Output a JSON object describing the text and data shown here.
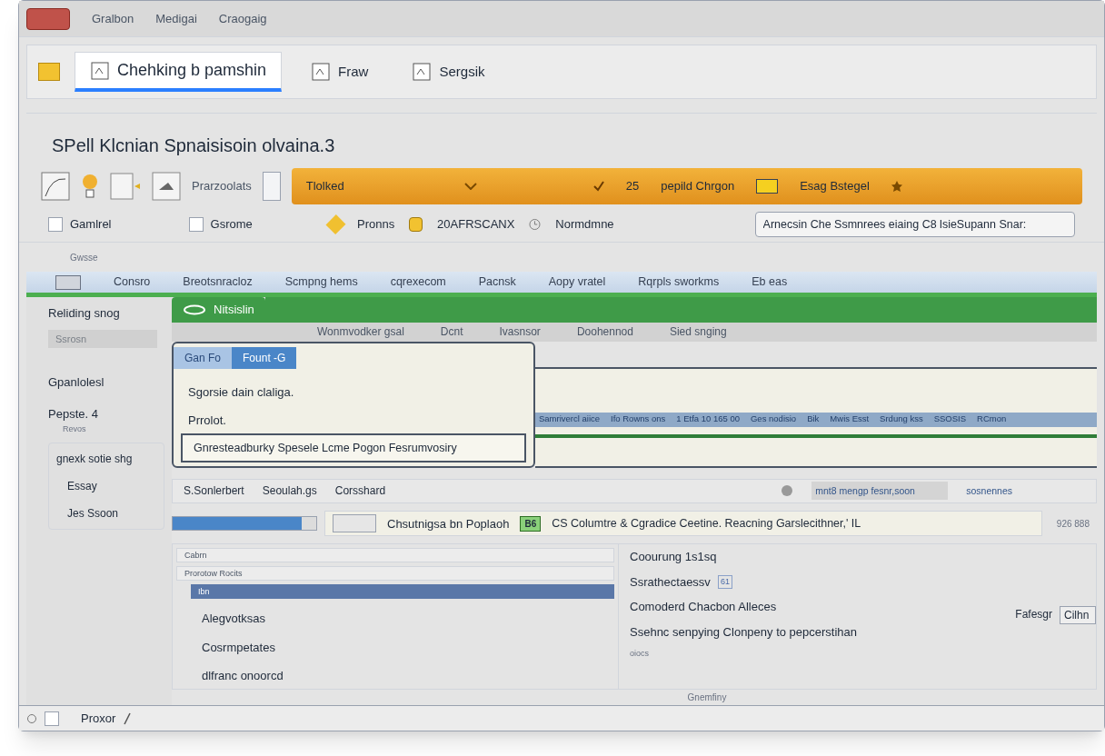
{
  "window": {
    "title_items": [
      "Gralbon",
      "Medigai",
      "Craogaig"
    ]
  },
  "toolbar": {
    "tabs": [
      {
        "label": "Chehking b pamshin",
        "selected": true
      },
      {
        "label": "Fraw",
        "selected": false
      },
      {
        "label": "Sergsik",
        "selected": false
      }
    ]
  },
  "heading": "SPell Klcnian Spnaisisoin olvaina.3",
  "ribbon": {
    "label": "Prarzoolats",
    "banner": {
      "dropdown": "Tlolked",
      "count": "25",
      "text": "pepild Chrgon",
      "tag": "Esag Bstegel"
    }
  },
  "options": {
    "checks": [
      {
        "label": "Gamlrel",
        "checked": false
      },
      {
        "label": "Gsrome",
        "checked": false
      }
    ],
    "tags": [
      "Pronns",
      "20AFRSCANX"
    ],
    "mode": "Normdmne",
    "field": {
      "value": "Arnecsin Che Ssmnrees eiaing C8 lsieSupann Snar:"
    }
  },
  "section_label": "Gwsse",
  "nav_bar": {
    "items": [
      "Consro",
      "Breotsnracloz",
      "Scmpng hems",
      "cqrexecom",
      "Pacnsk",
      "Aopy vratel",
      "Rqrpls sworkms",
      "Eb eas"
    ]
  },
  "sidebar": {
    "title": "Reliding snog",
    "search": {
      "placeholder": "Ssrosn"
    },
    "heading": "Gpanlolesl",
    "page": "Pepste. 4",
    "sub": "Revos",
    "group": {
      "title": "gnexk sotie shg",
      "items": [
        "Essay",
        "Jes Ssoon"
      ]
    }
  },
  "doc_tab": {
    "label": "Nitsislin"
  },
  "doc_header": {
    "items": [
      "Wonmvodker gsal",
      "Dcnt",
      "Ivasnsor",
      "Doohennod",
      "Sied snging"
    ]
  },
  "popup": {
    "tabs": [
      {
        "label": "Gan Fo",
        "selected": false
      },
      {
        "label": "Fount -G",
        "selected": true
      }
    ],
    "title": "Sgorsie dain claliga.",
    "label": "Prrolot.",
    "field": {
      "value": "Gnresteadburky Spesele Lcme Pogon Fesrumvosiry"
    }
  },
  "columns": [
    "Samrivercl aiice",
    "Ifo Rowns ons",
    "1 Etfa 10 165 00",
    "Ges nodisio",
    "Bik",
    "Mwis Esst",
    "Srdung kss",
    "SSOSIS",
    "RCmon"
  ],
  "find_bar": {
    "items": [
      "S.Sonlerbert",
      "Seoulah.gs",
      "Corsshard"
    ],
    "search": {
      "value": "mnt8 mengp fesnr,soon"
    },
    "extra": "sosnennes"
  },
  "replace_bar": {
    "slider": {
      "level": 0.9
    },
    "field": {
      "value": "Chsutnigsa bn Poplaoh"
    },
    "badge": "B6",
    "text": "CS Columtre & Cgradice Ceetine. Reacning Garslecithner,' IL",
    "count": "926 888"
  },
  "list": {
    "rows": [
      {
        "label": "Cabrn",
        "selected": false
      },
      {
        "label": "Prorotow Rocits",
        "selected": false
      },
      {
        "label": "Ibn",
        "selected": true
      }
    ],
    "items": [
      "Alegvotksas",
      "Cosrmpetates",
      "dlfranc onoorcd"
    ]
  },
  "details": {
    "lines": [
      "Coourung 1s1sq",
      "Ssrathectaessv",
      "Comoderd Chacbon Alleces",
      "Ssehnc senpying Clonpeny to pepcerstihan",
      "oiocs"
    ],
    "tag": "61",
    "field_label": "Fafesgr",
    "field": {
      "value": "Cilhn"
    }
  },
  "footer_note": "Gnemfiny",
  "status_bar": {
    "label": "Proxor",
    "checked": false
  }
}
